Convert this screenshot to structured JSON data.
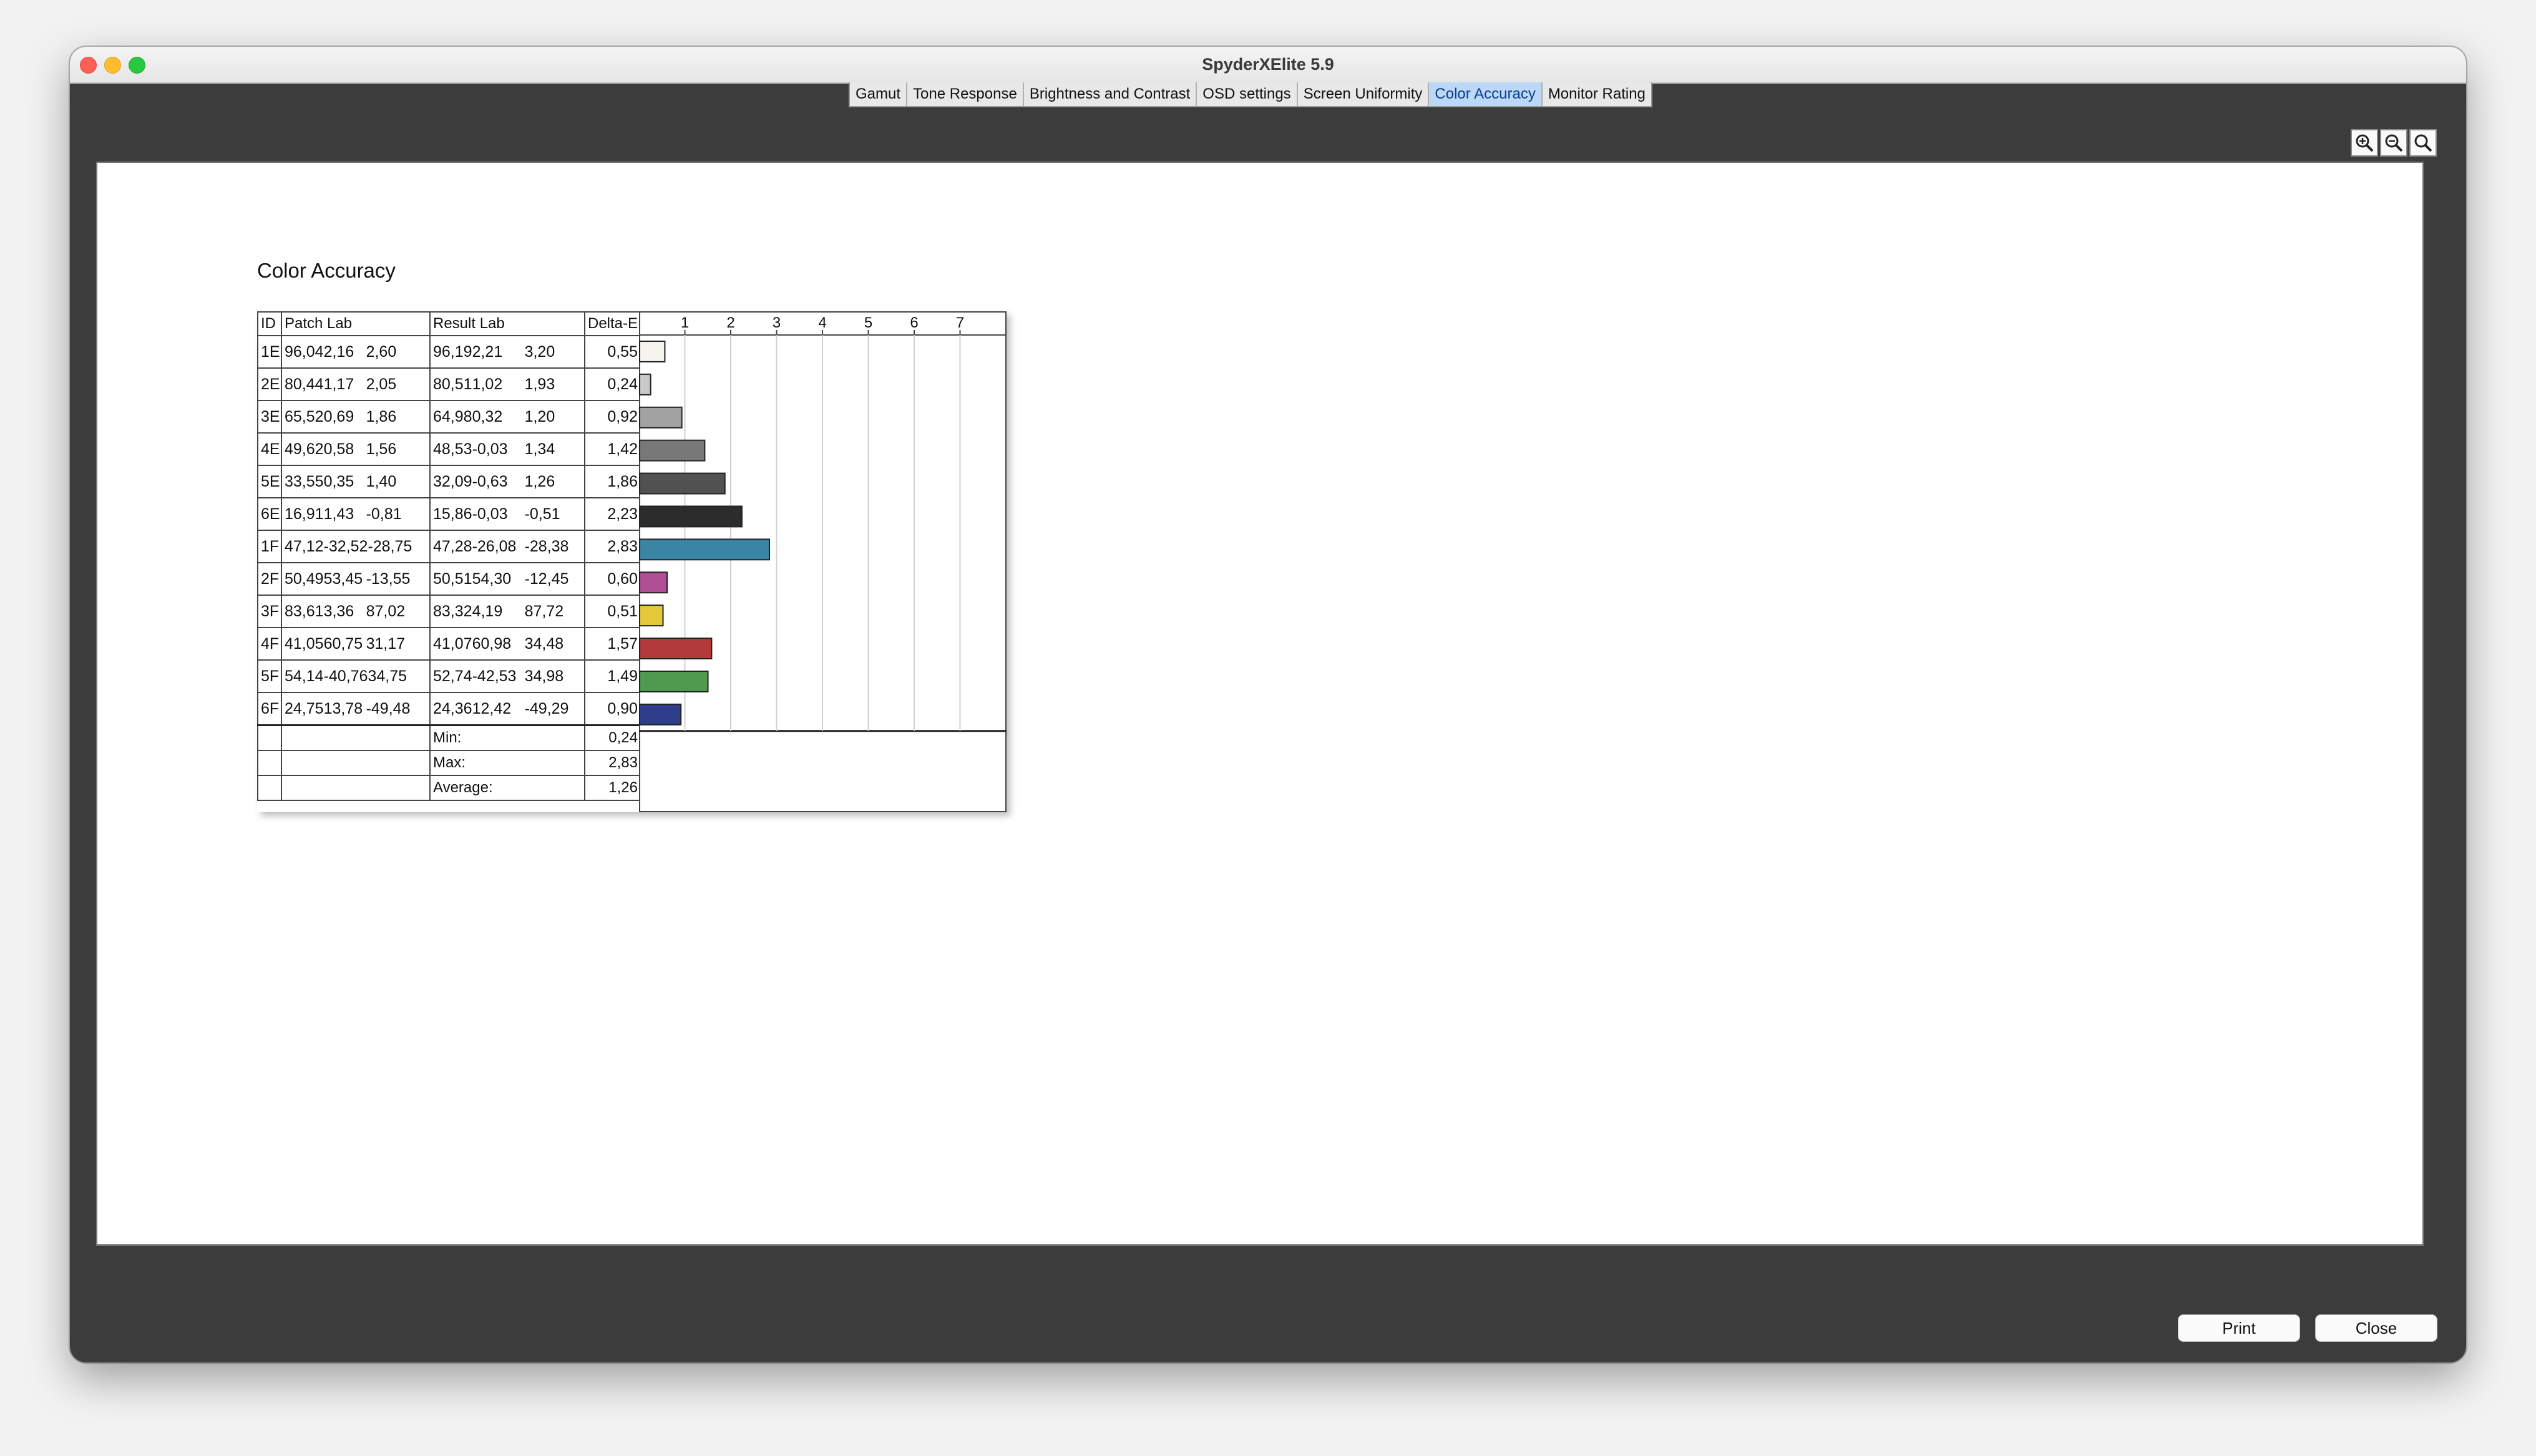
{
  "window": {
    "title": "SpyderXElite 5.9"
  },
  "tabs": [
    {
      "label": "Gamut",
      "active": false
    },
    {
      "label": "Tone Response",
      "active": false
    },
    {
      "label": "Brightness and Contrast",
      "active": false
    },
    {
      "label": "OSD settings",
      "active": false
    },
    {
      "label": "Screen Uniformity",
      "active": false
    },
    {
      "label": "Color Accuracy",
      "active": true
    },
    {
      "label": "Monitor Rating",
      "active": false
    }
  ],
  "zoom_controls": [
    "zoom-in-icon",
    "zoom-out-icon",
    "zoom-reset-icon"
  ],
  "report": {
    "title": "Color Accuracy",
    "headers": {
      "id": "ID",
      "patch": "Patch Lab",
      "result": "Result Lab",
      "delta": "Delta-E"
    },
    "rows": [
      {
        "id": "1E",
        "patch": [
          "96,04",
          "2,16",
          "2,60"
        ],
        "result": [
          "96,19",
          "2,21",
          "3,20"
        ],
        "delta": "0,55",
        "color": "#f6f4ef"
      },
      {
        "id": "2E",
        "patch": [
          "80,44",
          "1,17",
          "2,05"
        ],
        "result": [
          "80,51",
          "1,02",
          "1,93"
        ],
        "delta": "0,24",
        "color": "#c9c9c9"
      },
      {
        "id": "3E",
        "patch": [
          "65,52",
          "0,69",
          "1,86"
        ],
        "result": [
          "64,98",
          "0,32",
          "1,20"
        ],
        "delta": "0,92",
        "color": "#a2a2a2"
      },
      {
        "id": "4E",
        "patch": [
          "49,62",
          "0,58",
          "1,56"
        ],
        "result": [
          "48,53",
          "-0,03",
          "1,34"
        ],
        "delta": "1,42",
        "color": "#787878"
      },
      {
        "id": "5E",
        "patch": [
          "33,55",
          "0,35",
          "1,40"
        ],
        "result": [
          "32,09",
          "-0,63",
          "1,26"
        ],
        "delta": "1,86",
        "color": "#515151"
      },
      {
        "id": "6E",
        "patch": [
          "16,91",
          "1,43",
          "-0,81"
        ],
        "result": [
          "15,86",
          "-0,03",
          "-0,51"
        ],
        "delta": "2,23",
        "color": "#2c2c2c"
      },
      {
        "id": "1F",
        "patch": [
          "47,12",
          "-32,52",
          "-28,75"
        ],
        "result": [
          "47,28",
          "-26,08",
          "-28,38"
        ],
        "delta": "2,83",
        "color": "#3a84a4"
      },
      {
        "id": "2F",
        "patch": [
          "50,49",
          "53,45",
          "-13,55"
        ],
        "result": [
          "50,51",
          "54,30",
          "-12,45"
        ],
        "delta": "0,60",
        "color": "#b04f96"
      },
      {
        "id": "3F",
        "patch": [
          "83,61",
          "3,36",
          "87,02"
        ],
        "result": [
          "83,32",
          "4,19",
          "87,72"
        ],
        "delta": "0,51",
        "color": "#e6c93a"
      },
      {
        "id": "4F",
        "patch": [
          "41,05",
          "60,75",
          "31,17"
        ],
        "result": [
          "41,07",
          "60,98",
          "34,48"
        ],
        "delta": "1,57",
        "color": "#b23a3a"
      },
      {
        "id": "5F",
        "patch": [
          "54,14",
          "-40,76",
          "34,75"
        ],
        "result": [
          "52,74",
          "-42,53",
          "34,98"
        ],
        "delta": "1,49",
        "color": "#4e9a4e"
      },
      {
        "id": "6F",
        "patch": [
          "24,75",
          "13,78",
          "-49,48"
        ],
        "result": [
          "24,36",
          "12,42",
          "-49,29"
        ],
        "delta": "0,90",
        "color": "#2f3e8a"
      }
    ],
    "summary": [
      {
        "label": "Min:",
        "value": "0,24"
      },
      {
        "label": "Max:",
        "value": "2,83"
      },
      {
        "label": "Average:",
        "value": "1,26"
      }
    ]
  },
  "chart_data": {
    "type": "bar",
    "orientation": "horizontal",
    "categories": [
      "1E",
      "2E",
      "3E",
      "4E",
      "5E",
      "6E",
      "1F",
      "2F",
      "3F",
      "4F",
      "5F",
      "6F"
    ],
    "values": [
      0.55,
      0.24,
      0.92,
      1.42,
      1.86,
      2.23,
      2.83,
      0.6,
      0.51,
      1.57,
      1.49,
      0.9
    ],
    "xticks": [
      "1",
      "2",
      "3",
      "4",
      "5",
      "6",
      "7"
    ],
    "xlim": [
      0,
      8
    ],
    "grid": true
  },
  "buttons": {
    "print": "Print",
    "close": "Close"
  }
}
